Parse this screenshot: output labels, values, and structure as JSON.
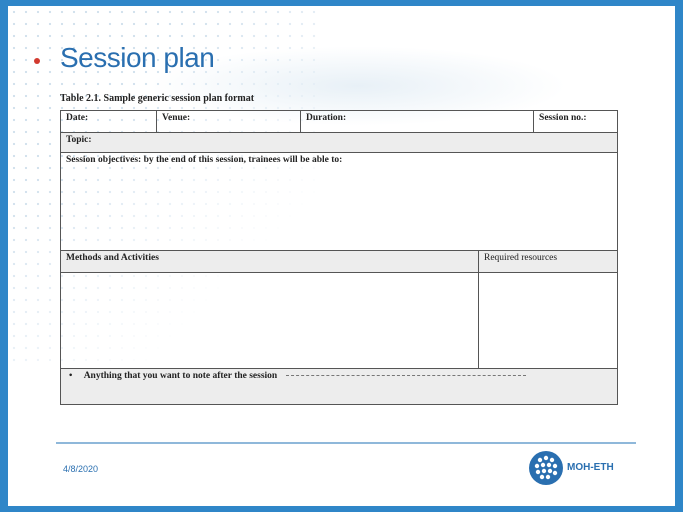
{
  "slide": {
    "title": "Session plan",
    "table_caption": "Table 2.1. Sample generic session plan format",
    "table": {
      "date_label": "Date:",
      "venue_label": "Venue:",
      "duration_label": "Duration:",
      "session_no_label": "Session no.:",
      "topic_label": "Topic:",
      "objectives_label": "Session objectives: by the end of this session, trainees will be able to:",
      "methods_label": "Methods and Activities",
      "resources_label": "Required resources",
      "note_bullet": "•",
      "note_label": "Anything that you want to note after the session"
    },
    "footer": {
      "date": "4/8/2020",
      "logo_text": "MOH-ETH"
    }
  },
  "colors": {
    "frame": "#2f86c8",
    "title": "#2a6fb0",
    "accent_dot": "#d23a2f"
  }
}
